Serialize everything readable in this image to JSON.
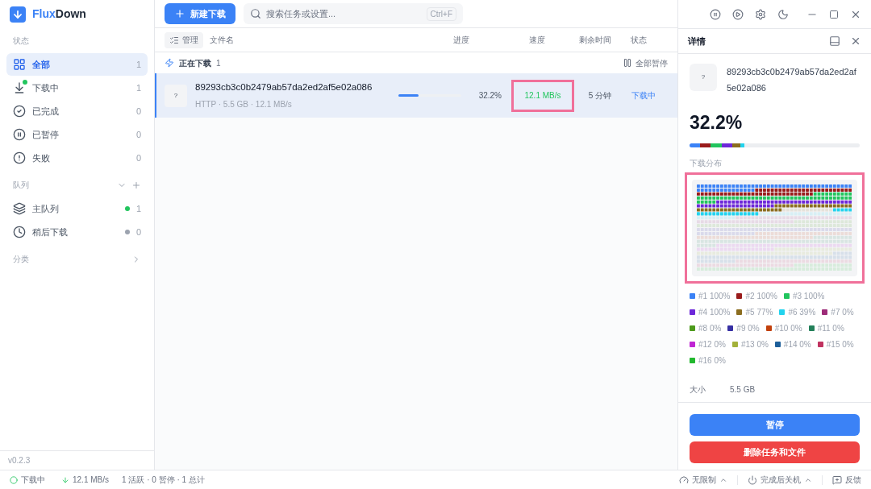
{
  "app": {
    "name_a": "Flux",
    "name_b": "Down",
    "version": "v0.2.3"
  },
  "sidebar": {
    "status_heading": "状态",
    "status_items": [
      {
        "label": "全部",
        "count": "1",
        "selected": true
      },
      {
        "label": "下载中",
        "count": "1",
        "selected": false
      },
      {
        "label": "已完成",
        "count": "0",
        "selected": false
      },
      {
        "label": "已暂停",
        "count": "0",
        "selected": false
      },
      {
        "label": "失败",
        "count": "0",
        "selected": false
      }
    ],
    "queue_heading": "队列",
    "queues": [
      {
        "label": "主队列",
        "count": "1",
        "color": "#22c55e",
        "selected": false
      },
      {
        "label": "稍后下载",
        "count": "0",
        "color": "#9ca3af",
        "selected": false
      }
    ],
    "category_heading": "分类"
  },
  "toolbar": {
    "new_button": "新建下载",
    "search_placeholder": "搜索任务或设置...",
    "shortcut": "Ctrl+F"
  },
  "table": {
    "manage_button": "管理",
    "columns": [
      "文件名",
      "进度",
      "速度",
      "剩余时间",
      "状态"
    ],
    "group": {
      "label": "正在下载",
      "count": "1",
      "action": "全部暂停"
    },
    "rows": [
      {
        "icon": "?",
        "name": "89293cb3c0b2479ab57da2ed2af5e02a086",
        "meta": "HTTP · 5.5 GB · 12.1 MB/s",
        "level": 0.322,
        "progress": "32.2%",
        "speed": "12.1 MB/s",
        "speed_highlighted": true,
        "remaining": "5 分钟",
        "status": "下载中",
        "selected": true
      }
    ]
  },
  "details": {
    "title": "详情",
    "icon": "?",
    "name": "89293cb3c0b2479ab57da2ed2af5e02a086",
    "percent": "32.2%",
    "level": 0.322,
    "distribution_label": "下载分布",
    "map_highlighted": true,
    "threads": [
      {
        "label": "#1 100%",
        "color": "#3b82f6"
      },
      {
        "label": "#2 100%",
        "color": "#991b1b"
      },
      {
        "label": "#3 100%",
        "color": "#22c55e"
      },
      {
        "label": "#4 100%",
        "color": "#6d28d9"
      },
      {
        "label": "#5 77%",
        "color": "#8b6d1f"
      },
      {
        "label": "#6 39%",
        "color": "#22d3ee"
      },
      {
        "label": "#7 0%",
        "color": "#9d2b78"
      },
      {
        "label": "#8 0%",
        "color": "#4d9a1c"
      },
      {
        "label": "#9 0%",
        "color": "#3730a3"
      },
      {
        "label": "#10 0%",
        "color": "#c2410c"
      },
      {
        "label": "#11 0%",
        "color": "#23805a"
      },
      {
        "label": "#12 0%",
        "color": "#c026d3"
      },
      {
        "label": "#13 0%",
        "color": "#a3b13a"
      },
      {
        "label": "#14 0%",
        "color": "#1d5f9a"
      },
      {
        "label": "#15 0%",
        "color": "#c0325f"
      },
      {
        "label": "#16 0%",
        "color": "#22b82e"
      }
    ],
    "size_label": "大小",
    "size_value": "5.5 GB",
    "pause_button": "暂停",
    "delete_button": "删除任务和文件"
  },
  "status_bar": {
    "state": "下载中",
    "speed": "12.1 MB/s",
    "summary": "1 活跃 · 0 暂停 · 1 总计",
    "limit": "无限制",
    "shutdown": "完成后关机",
    "feedback": "反馈"
  }
}
